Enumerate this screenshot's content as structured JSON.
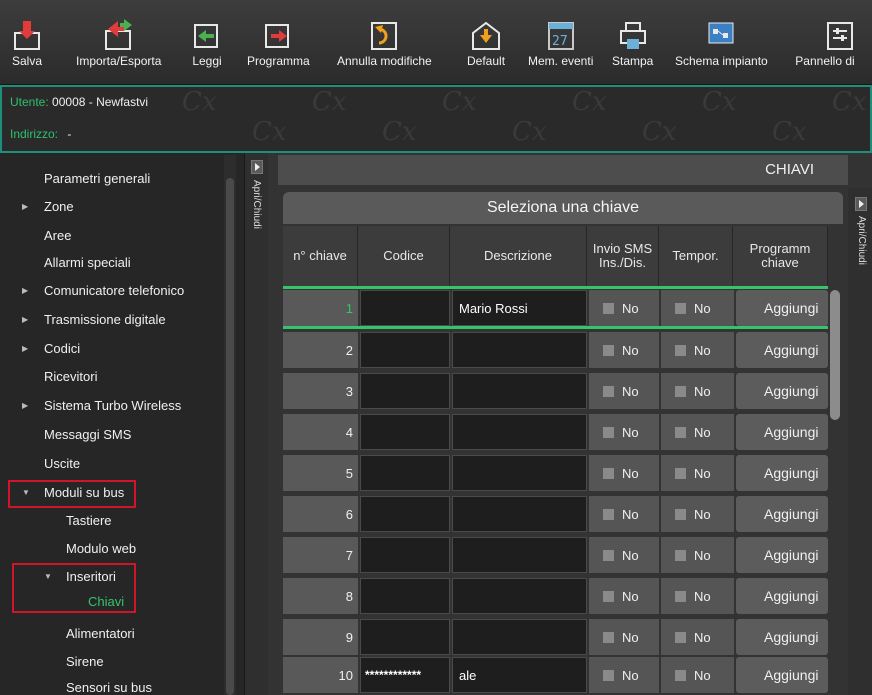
{
  "toolbar": {
    "buttons": [
      {
        "label": "Salva",
        "icon": "save-icon"
      },
      {
        "label": "Importa/Esporta",
        "icon": "import-export-icon"
      },
      {
        "label": "Leggi",
        "icon": "read-icon"
      },
      {
        "label": "Programma",
        "icon": "program-icon"
      },
      {
        "label": "Annulla modifiche",
        "icon": "undo-icon"
      },
      {
        "label": "Default",
        "icon": "default-icon"
      },
      {
        "label": "Mem. eventi",
        "icon": "event-memory-icon"
      },
      {
        "label": "Stampa",
        "icon": "print-icon"
      },
      {
        "label": "Schema impianto",
        "icon": "system-schema-icon"
      },
      {
        "label": "Pannello di",
        "icon": "panel-icon"
      }
    ]
  },
  "info": {
    "user_label": "Utente:",
    "user_value": "00008  -  Newfastvi",
    "address_label": "Indirizzo:",
    "address_value": "-",
    "watermark": "Cx"
  },
  "sidebar": {
    "toggle_label": "Apri/Chiudi",
    "items": [
      {
        "label": "Parametri generali"
      },
      {
        "label": "Zone"
      },
      {
        "label": "Aree"
      },
      {
        "label": "Allarmi speciali"
      },
      {
        "label": "Comunicatore telefonico"
      },
      {
        "label": "Trasmissione digitale"
      },
      {
        "label": "Codici"
      },
      {
        "label": "Ricevitori"
      },
      {
        "label": "Sistema Turbo Wireless"
      },
      {
        "label": "Messaggi SMS"
      },
      {
        "label": "Uscite"
      },
      {
        "label": "Moduli su bus"
      },
      {
        "label": "Tastiere"
      },
      {
        "label": "Modulo web"
      },
      {
        "label": "Inseritori"
      },
      {
        "label": "Chiavi"
      },
      {
        "label": "Alimentatori"
      },
      {
        "label": "Sirene"
      },
      {
        "label": "Sensori su bus"
      }
    ]
  },
  "main": {
    "title": "CHIAVI",
    "subtitle": "Seleziona una chiave",
    "right_toggle_label": "Apri/Chiudi",
    "columns": [
      "n° chiave",
      "Codice",
      "Descrizione",
      "Invio SMS Ins./Dis.",
      "Tempor.",
      "Programm chiave"
    ],
    "rows": [
      {
        "num": "1",
        "code": "",
        "desc": "Mario Rossi",
        "sms": "No",
        "temp": "No",
        "action": "Aggiungi"
      },
      {
        "num": "2",
        "code": "",
        "desc": "",
        "sms": "No",
        "temp": "No",
        "action": "Aggiungi"
      },
      {
        "num": "3",
        "code": "",
        "desc": "",
        "sms": "No",
        "temp": "No",
        "action": "Aggiungi"
      },
      {
        "num": "4",
        "code": "",
        "desc": "",
        "sms": "No",
        "temp": "No",
        "action": "Aggiungi"
      },
      {
        "num": "5",
        "code": "",
        "desc": "",
        "sms": "No",
        "temp": "No",
        "action": "Aggiungi"
      },
      {
        "num": "6",
        "code": "",
        "desc": "",
        "sms": "No",
        "temp": "No",
        "action": "Aggiungi"
      },
      {
        "num": "7",
        "code": "",
        "desc": "",
        "sms": "No",
        "temp": "No",
        "action": "Aggiungi"
      },
      {
        "num": "8",
        "code": "",
        "desc": "",
        "sms": "No",
        "temp": "No",
        "action": "Aggiungi"
      },
      {
        "num": "9",
        "code": "",
        "desc": "",
        "sms": "No",
        "temp": "No",
        "action": "Aggiungi"
      },
      {
        "num": "10",
        "code": "************",
        "desc": "ale",
        "sms": "No",
        "temp": "No",
        "action": "Aggiungi"
      }
    ]
  },
  "colors": {
    "accent_green": "#35c46a",
    "highlight_red": "#d0142a",
    "infobar_border": "#1d8f7a"
  }
}
